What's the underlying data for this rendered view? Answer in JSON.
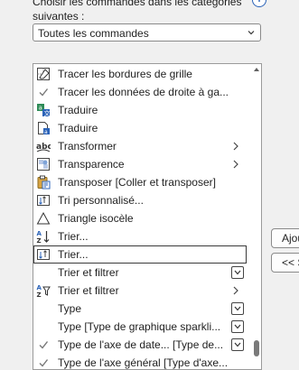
{
  "header": {
    "label_line1": "Choisir les commandes dans les catégories",
    "label_line2": "suivantes :",
    "info_glyph": "i"
  },
  "category_select": {
    "value": "Toutes les commandes"
  },
  "commands": [
    {
      "label": "Tracer les bordures de grille",
      "icon": "grid-borders-icon"
    },
    {
      "label": "Tracer les données de droite à ga...",
      "icon": "checkmark-icon"
    },
    {
      "label": "Traduire",
      "icon": "translate-icon"
    },
    {
      "label": "Traduire",
      "icon": "translate-doc-icon"
    },
    {
      "label": "Transformer",
      "icon": "transform-text-icon",
      "submenu": true
    },
    {
      "label": "Transparence",
      "icon": "transparency-icon",
      "submenu": true
    },
    {
      "label": "Transposer [Coller et transposer]",
      "icon": "paste-transpose-icon"
    },
    {
      "label": "Tri personnalisé...",
      "icon": "custom-sort-icon"
    },
    {
      "label": "Triangle isocèle",
      "icon": "triangle-icon"
    },
    {
      "label": "Trier...",
      "icon": "sort-az-icon"
    },
    {
      "label": "Trier...",
      "icon": "sort-dialog-icon",
      "selected": true
    },
    {
      "label": "Trier et filtrer",
      "icon": "none",
      "dropdown": true
    },
    {
      "label": "Trier et filtrer",
      "icon": "sort-filter-icon",
      "submenu": true
    },
    {
      "label": "Type",
      "icon": "none",
      "dropdown": true
    },
    {
      "label": "Type [Type de graphique sparkli...",
      "icon": "none",
      "dropdown": true
    },
    {
      "label": "Type de l'axe de date... [Type de...",
      "icon": "checkmark-icon",
      "dropdown": true
    },
    {
      "label": "Type de l'axe général [Type d'axe...",
      "icon": "checkmark-icon"
    }
  ],
  "side_buttons": {
    "add_label": "Ajouter >>",
    "remove_label": "<< Supprimer"
  }
}
